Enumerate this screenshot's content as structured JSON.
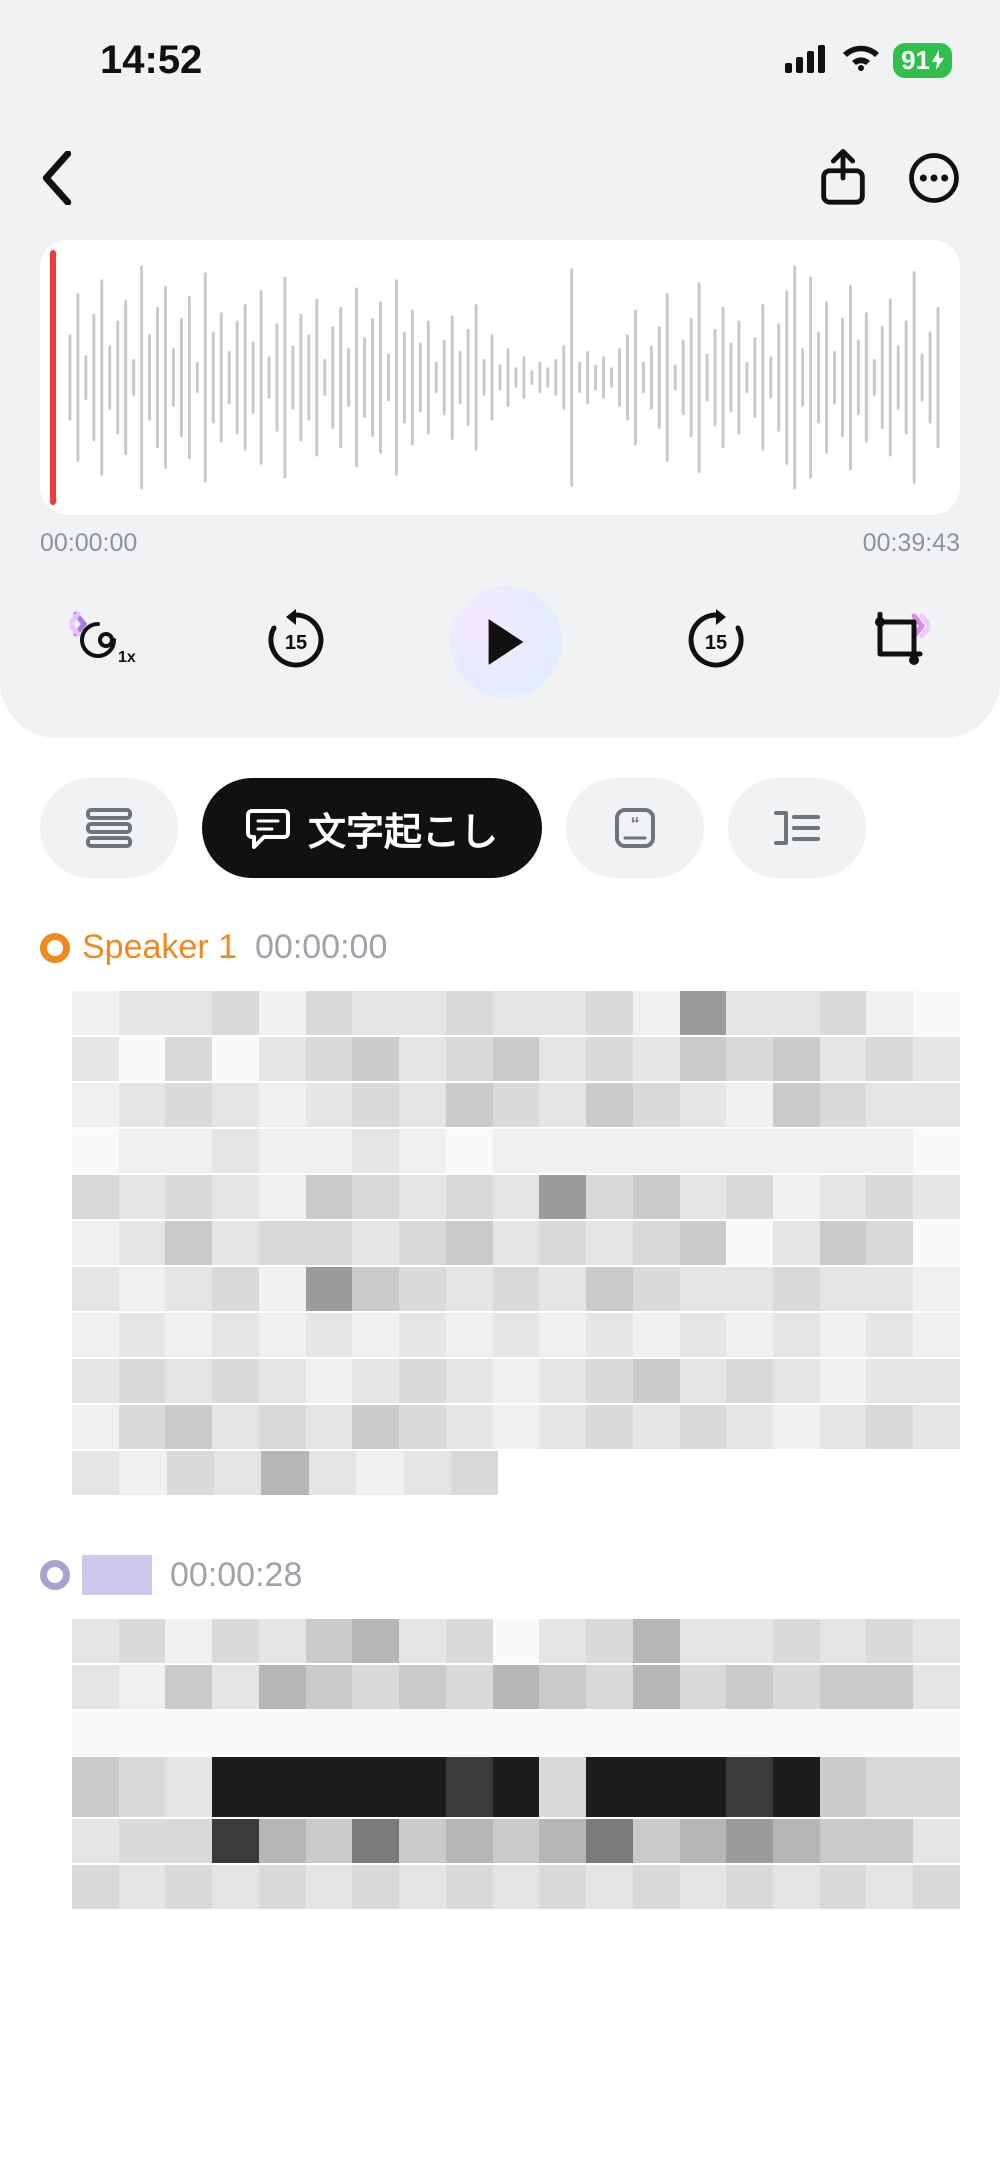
{
  "status": {
    "time": "14:52",
    "battery": "91"
  },
  "audio": {
    "start_time": "00:00:00",
    "end_time": "00:39:43"
  },
  "tabs": {
    "active_label": "文字起こし"
  },
  "transcript": {
    "entries": [
      {
        "speaker_label": "Speaker 1",
        "timestamp": "00:00:00"
      },
      {
        "speaker_label": "",
        "timestamp": "00:00:28"
      }
    ]
  },
  "controls": {
    "speed_label": "1x",
    "skip_back_seconds": "15",
    "skip_fwd_seconds": "15"
  },
  "colors": {
    "speaker1": "#ef8a1f",
    "speaker2": "#a9a0d6",
    "playhead": "#f43939"
  }
}
